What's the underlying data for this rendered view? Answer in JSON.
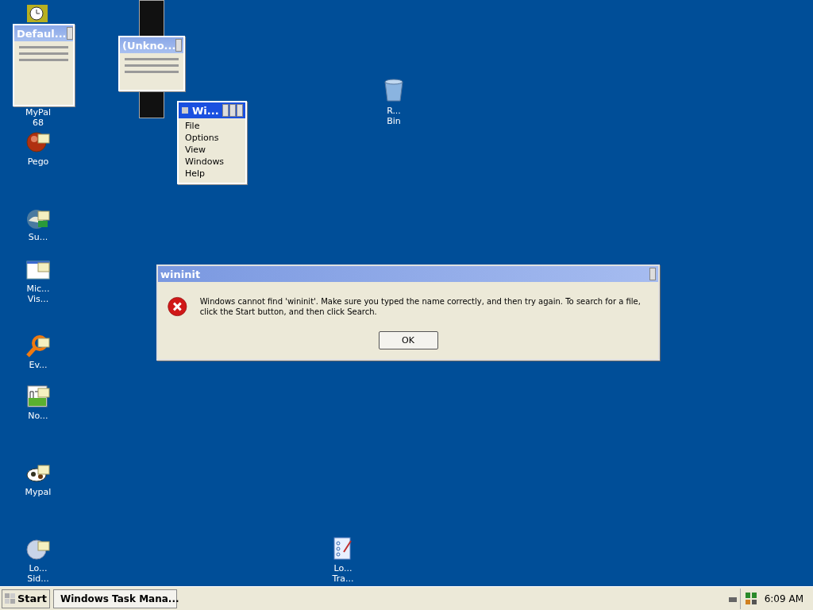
{
  "desktop_icons": [
    {
      "label": [
        "MyPal",
        "68"
      ]
    },
    {
      "label": [
        "Pego"
      ]
    },
    {
      "label": [
        "Su..."
      ]
    },
    {
      "label": [
        "Mic...",
        "Vis..."
      ]
    },
    {
      "label": [
        "Ev..."
      ]
    },
    {
      "label": [
        "No..."
      ]
    },
    {
      "label": [
        "Mypal"
      ]
    },
    {
      "label": [
        "Lo...",
        "Sid..."
      ]
    },
    {
      "label": [
        "R...",
        "Bin"
      ]
    },
    {
      "label": [
        "Lo...",
        "Tra..."
      ]
    }
  ],
  "mini_windows": [
    {
      "title": "Defaul..."
    },
    {
      "title": "(Unkno..."
    }
  ],
  "menu_window": {
    "title": "Wi...",
    "items": [
      "File",
      "Options",
      "View",
      "Windows",
      "Help"
    ]
  },
  "dialog": {
    "title": "wininit",
    "message": "Windows cannot find 'wininit'. Make sure you typed the name correctly, and then try again. To search for a file, click the Start button, and then click Search.",
    "button": "OK"
  },
  "taskbar": {
    "start": "Start",
    "tasks": [
      {
        "label": "Windows Task Mana..."
      }
    ],
    "clock": "6:09 AM"
  }
}
